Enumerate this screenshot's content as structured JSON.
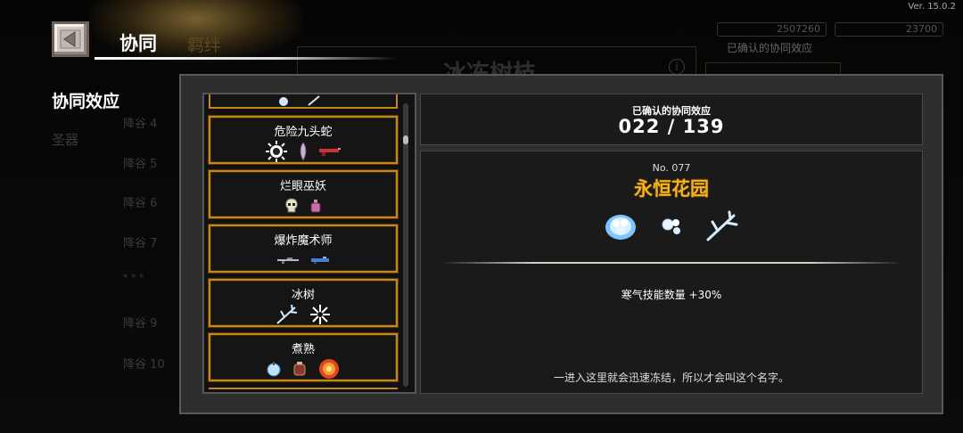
{
  "version": "Ver. 15.0.2",
  "header": {
    "tab_active": "协同",
    "tab_ghost": "羁绊"
  },
  "ghost_background": {
    "big_title": "冰冻树枝",
    "res_left": "2507260",
    "res_right": "23700",
    "confirmed_small": "已确认的协同效应",
    "sidebar_items": [
      "圣器",
      "降谷 4",
      "降谷 5",
      "降谷 6",
      "降谷 7",
      "* * *",
      "降谷 9",
      "降谷 10"
    ]
  },
  "sidebar": {
    "active_label": "协同效应"
  },
  "synergy_list": [
    {
      "name": "危险九头蛇",
      "icons": [
        "burst-icon",
        "feather-icon",
        "gun-icon"
      ]
    },
    {
      "name": "烂眼巫妖",
      "icons": [
        "skull-icon",
        "potion-icon"
      ]
    },
    {
      "name": "爆炸魔术师",
      "icons": [
        "rifle-icon",
        "launcher-icon"
      ]
    },
    {
      "name": "冰树",
      "icons": [
        "frozen-branch-icon",
        "snowflake-icon"
      ]
    },
    {
      "name": "煮熟",
      "icons": [
        "ice-apple-icon",
        "pot-icon",
        "fireball-icon"
      ]
    }
  ],
  "summary": {
    "label": "已确认的协同效应",
    "count": "022 / 139"
  },
  "detail": {
    "number": "No. 077",
    "name": "永恒花园",
    "icons": [
      "frost-flower-icon",
      "frost-petal-icon",
      "frozen-branch-icon"
    ],
    "effect": "寒气技能数量 +30%",
    "flavor": "一进入这里就会迅速冻结，所以才会叫这个名字。"
  },
  "colors": {
    "accent_gold": "#f3b21e",
    "item_border": "#c8871c",
    "panel_bg": "#2e2e2e"
  }
}
